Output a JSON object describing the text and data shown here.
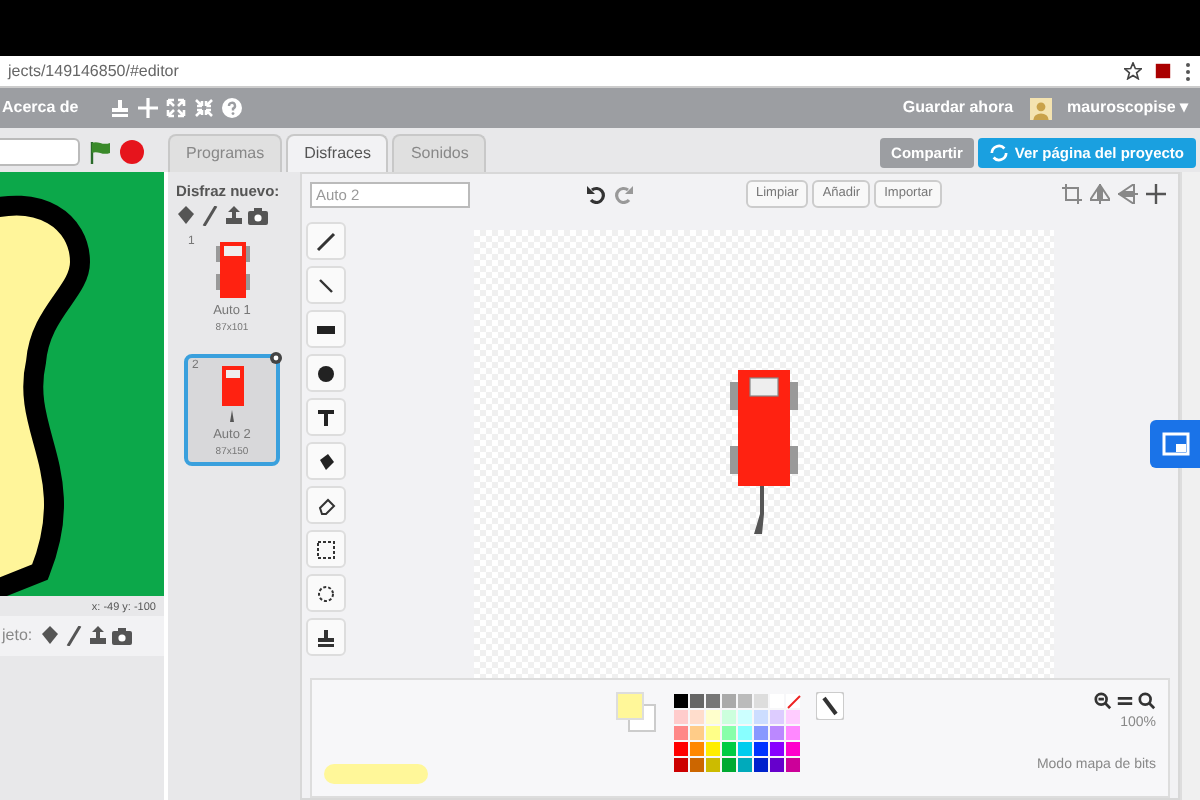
{
  "browser": {
    "url": "jects/149146850/#editor"
  },
  "menu_bar": {
    "item": "Acerca de",
    "save": "Guardar ahora",
    "user": "mauroscopise ▾"
  },
  "stage": {
    "coords": "x: -49  y: -100"
  },
  "sprite_bar": {
    "label": "jeto:"
  },
  "tabs": [
    {
      "label": "Programas",
      "selected": false
    },
    {
      "label": "Disfraces",
      "selected": true
    },
    {
      "label": "Sonidos",
      "selected": false
    }
  ],
  "share_button": "Compartir",
  "project_button": "Ver página del proyecto",
  "costumes": {
    "label": "Disfraz nuevo:",
    "items": [
      {
        "number": "1",
        "name": "Auto 1",
        "size": "87x101",
        "kind": "plain",
        "selected": false
      },
      {
        "number": "2",
        "name": "Auto 2",
        "size": "87x150",
        "kind": "tailed",
        "selected": true
      }
    ]
  },
  "editor": {
    "name_value": "Auto 2",
    "buttons": [
      "Limpiar",
      "Añadir",
      "Importar"
    ],
    "zoom": "100%",
    "mode": "Modo mapa de bits"
  }
}
